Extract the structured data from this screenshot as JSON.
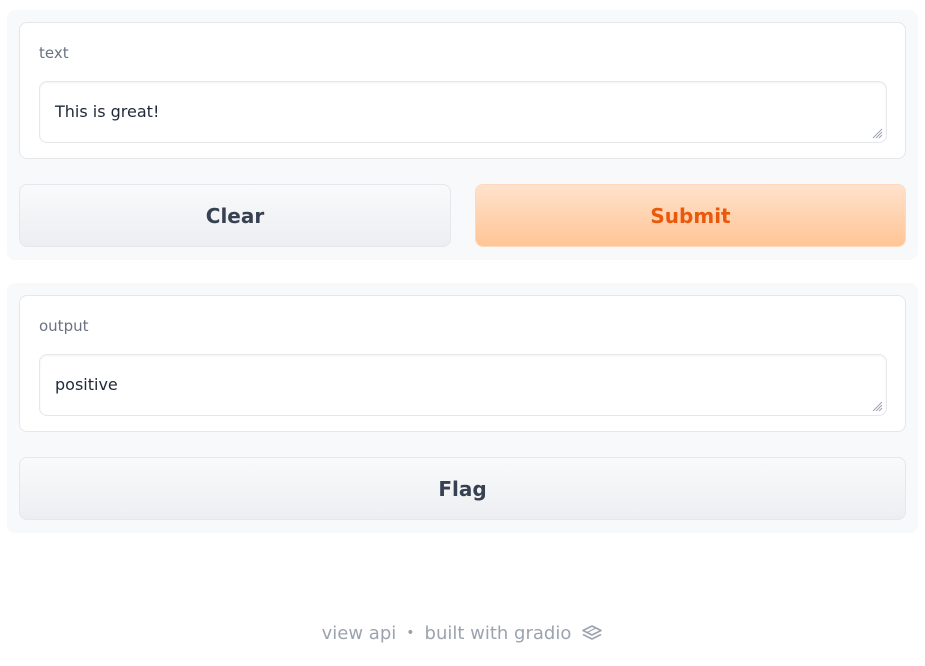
{
  "input_panel": {
    "text_label": "text",
    "text_value": "This is great!",
    "clear_label": "Clear",
    "submit_label": "Submit"
  },
  "output_panel": {
    "output_label": "output",
    "output_value": "positive",
    "flag_label": "Flag"
  },
  "footer": {
    "view_api": "view api",
    "separator": "•",
    "built_with": "built with gradio",
    "logo_icon": "gradio-logo-icon"
  },
  "colors": {
    "primary_text": "#ea580c",
    "primary_bg": "#ffd0ac",
    "panel_bg": "#f8f9fa"
  }
}
